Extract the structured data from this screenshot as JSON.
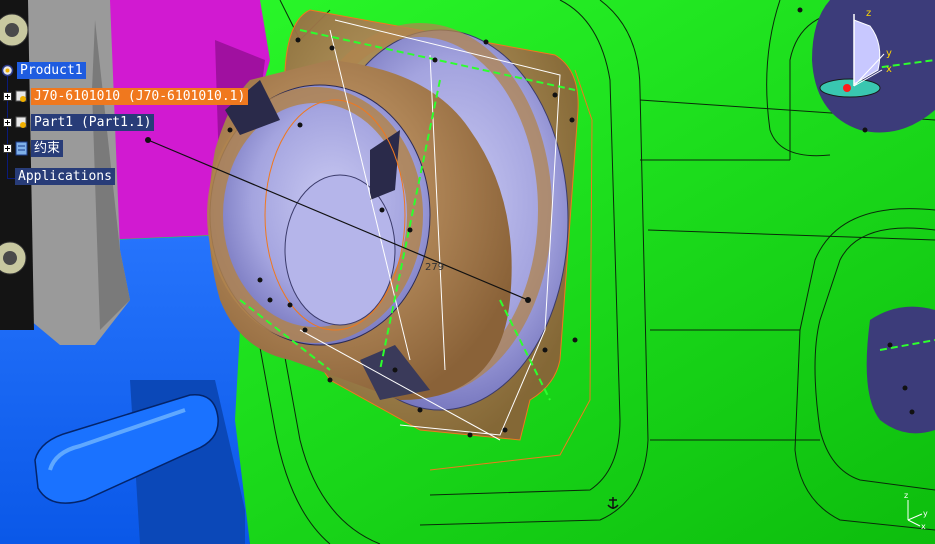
{
  "spec_tree": {
    "root": {
      "label": "Product1",
      "icon": "product-icon"
    },
    "items": [
      {
        "label": "J70-6101010 (J70-6101010.1)",
        "icon": "part-gear-icon",
        "state": "highlighted"
      },
      {
        "label": "Part1 (Part1.1)",
        "icon": "part-gear-icon",
        "state": "normal"
      },
      {
        "label": "约束",
        "icon": "constraints-icon",
        "state": "normal"
      },
      {
        "label": "Applications",
        "icon": "",
        "state": "normal"
      }
    ]
  },
  "compass": {
    "axis_x": "x",
    "axis_y": "y",
    "axis_z": "z"
  },
  "mini_axes": {
    "axis_x": "x",
    "axis_y": "y",
    "axis_z": "z"
  },
  "dimension_text": "279",
  "colors": {
    "green_panel": "#19e619",
    "magenta_panel": "#d21ad2",
    "blue_panel": "#1670ff",
    "speaker_bronze": "#b48a5a",
    "speaker_lavender": "#a9a9e6",
    "compass_bg": "#3c3c7a",
    "selected": "#1e5ce0",
    "highlight": "#f0781e"
  }
}
